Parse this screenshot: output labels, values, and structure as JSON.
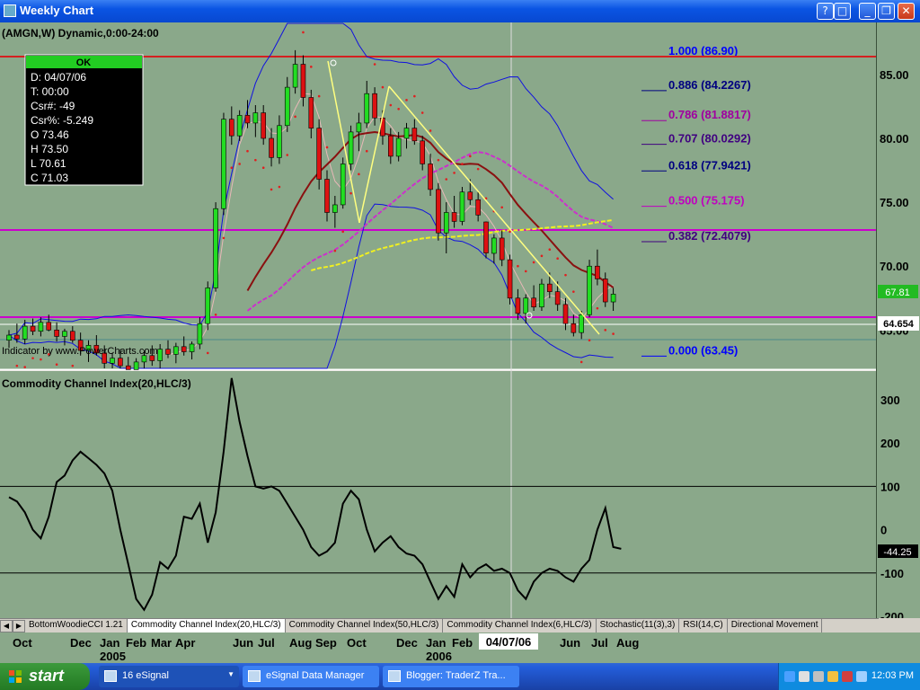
{
  "window": {
    "title": "Weekly Chart",
    "buttons": [
      "?",
      "□",
      "_",
      "❐",
      "✕"
    ]
  },
  "chart": {
    "symbol_label": "(AMGN,W) Dynamic,0:00-24:00",
    "cursor_box": {
      "ok": "OK",
      "rows": [
        "D: 04/07/06",
        "T: 00:00",
        "Csr#: -49",
        "Csr%: -5.249",
        "O 73.46",
        "H 73.50",
        "L 70.61",
        "C 71.03"
      ]
    },
    "indicator_credit": "Indicator by www.PowerCharts.com",
    "price_axis": [
      "85.00",
      "80.00",
      "75.00",
      "70.00",
      "65.00"
    ],
    "last_price_tag": "67.81",
    "hline_price_tag": "64.654",
    "fibs": [
      {
        "label": "1.000 (86.90)",
        "price": 86.9,
        "color": "#0000ff"
      },
      {
        "label": "0.886 (84.2267)",
        "price": 84.2267,
        "color": "#000080"
      },
      {
        "label": "0.786 (81.8817)",
        "price": 81.8817,
        "color": "#a000a0"
      },
      {
        "label": "0.707 (80.0292)",
        "price": 80.0292,
        "color": "#400080"
      },
      {
        "label": "0.618 (77.9421)",
        "price": 77.9421,
        "color": "#000080"
      },
      {
        "label": "0.500 (75.175)",
        "price": 75.175,
        "color": "#c000c0"
      },
      {
        "label": "0.382 (72.4079)",
        "price": 72.4079,
        "color": "#400080"
      },
      {
        "label": "0.000 (63.45)",
        "price": 63.45,
        "color": "#0000ff"
      }
    ]
  },
  "cci_panel": {
    "title": "Commodity Channel Index(20,HLC/3)",
    "axis": [
      "300",
      "200",
      "100",
      "0",
      "-100",
      "-200"
    ],
    "last_value": "-44.25"
  },
  "tabs": [
    "BottomWoodieCCI 1.21",
    "Commodity Channel Index(20,HLC/3)",
    "Commodity Channel Index(50,HLC/3)",
    "Commodity Channel Index(6,HLC/3)",
    "Stochastic(11(3),3)",
    "RSI(14,C)",
    "Directional Movement"
  ],
  "active_tab": 1,
  "time_axis": {
    "months": [
      "Oct",
      "Dec",
      "Jan",
      "Feb",
      "Mar",
      "Apr",
      "Jun",
      "Jul",
      "Aug",
      "Sep",
      "Oct",
      "Dec",
      "Jan",
      "Feb",
      "Jun",
      "Jul",
      "Aug"
    ],
    "years": [
      "2005",
      "2006"
    ],
    "cursor_date": "04/07/06"
  },
  "taskbar": {
    "start": "start",
    "items": [
      "16 eSignal",
      "eSignal Data Manager",
      "Blogger: TraderZ Tra..."
    ],
    "clock": "12:03 PM"
  },
  "chart_data": {
    "type": "candlestick",
    "title": "Weekly Chart",
    "ylim": [
      62,
      89
    ],
    "candles": [
      {
        "o": 64.2,
        "h": 65.0,
        "l": 63.6,
        "c": 64.6
      },
      {
        "o": 64.6,
        "h": 65.5,
        "l": 64.0,
        "c": 64.3
      },
      {
        "o": 64.3,
        "h": 65.8,
        "l": 63.9,
        "c": 65.3
      },
      {
        "o": 65.3,
        "h": 65.9,
        "l": 64.6,
        "c": 64.9
      },
      {
        "o": 64.9,
        "h": 66.0,
        "l": 64.5,
        "c": 65.6
      },
      {
        "o": 65.6,
        "h": 66.2,
        "l": 64.9,
        "c": 65.0
      },
      {
        "o": 65.0,
        "h": 65.6,
        "l": 64.1,
        "c": 64.5
      },
      {
        "o": 64.5,
        "h": 65.1,
        "l": 63.8,
        "c": 64.9
      },
      {
        "o": 64.9,
        "h": 65.3,
        "l": 64.0,
        "c": 64.2
      },
      {
        "o": 64.2,
        "h": 64.8,
        "l": 63.0,
        "c": 63.4
      },
      {
        "o": 63.4,
        "h": 64.2,
        "l": 62.5,
        "c": 63.8
      },
      {
        "o": 63.8,
        "h": 64.6,
        "l": 63.0,
        "c": 63.2
      },
      {
        "o": 63.2,
        "h": 63.8,
        "l": 62.0,
        "c": 62.4
      },
      {
        "o": 62.4,
        "h": 63.2,
        "l": 61.5,
        "c": 62.8
      },
      {
        "o": 62.8,
        "h": 63.5,
        "l": 61.8,
        "c": 62.2
      },
      {
        "o": 62.2,
        "h": 62.9,
        "l": 61.2,
        "c": 61.9
      },
      {
        "o": 61.9,
        "h": 62.8,
        "l": 61.3,
        "c": 62.5
      },
      {
        "o": 62.5,
        "h": 63.4,
        "l": 61.9,
        "c": 63.0
      },
      {
        "o": 63.0,
        "h": 63.8,
        "l": 62.2,
        "c": 62.6
      },
      {
        "o": 62.6,
        "h": 63.9,
        "l": 62.0,
        "c": 63.5
      },
      {
        "o": 63.5,
        "h": 64.2,
        "l": 62.8,
        "c": 63.1
      },
      {
        "o": 63.1,
        "h": 64.0,
        "l": 62.4,
        "c": 63.7
      },
      {
        "o": 63.7,
        "h": 64.5,
        "l": 63.0,
        "c": 63.3
      },
      {
        "o": 63.3,
        "h": 64.1,
        "l": 62.7,
        "c": 63.9
      },
      {
        "o": 63.9,
        "h": 66.0,
        "l": 63.5,
        "c": 65.5
      },
      {
        "o": 65.5,
        "h": 68.8,
        "l": 65.0,
        "c": 68.3
      },
      {
        "o": 68.3,
        "h": 75.0,
        "l": 68.0,
        "c": 74.5
      },
      {
        "o": 74.5,
        "h": 82.0,
        "l": 74.0,
        "c": 81.5
      },
      {
        "o": 81.5,
        "h": 82.5,
        "l": 79.5,
        "c": 80.2
      },
      {
        "o": 80.2,
        "h": 82.2,
        "l": 79.8,
        "c": 81.8
      },
      {
        "o": 81.8,
        "h": 83.0,
        "l": 80.8,
        "c": 81.2
      },
      {
        "o": 81.2,
        "h": 82.6,
        "l": 80.1,
        "c": 82.0
      },
      {
        "o": 82.0,
        "h": 82.6,
        "l": 79.5,
        "c": 80.0
      },
      {
        "o": 80.0,
        "h": 80.8,
        "l": 77.8,
        "c": 78.5
      },
      {
        "o": 78.5,
        "h": 81.8,
        "l": 78.0,
        "c": 81.0
      },
      {
        "o": 81.0,
        "h": 84.8,
        "l": 80.5,
        "c": 84.0
      },
      {
        "o": 84.0,
        "h": 86.9,
        "l": 83.5,
        "c": 85.8
      },
      {
        "o": 85.8,
        "h": 86.5,
        "l": 82.5,
        "c": 83.2
      },
      {
        "o": 83.2,
        "h": 83.8,
        "l": 80.0,
        "c": 80.8
      },
      {
        "o": 80.8,
        "h": 81.5,
        "l": 76.0,
        "c": 76.8
      },
      {
        "o": 76.8,
        "h": 77.5,
        "l": 73.5,
        "c": 74.2
      },
      {
        "o": 74.2,
        "h": 75.5,
        "l": 73.0,
        "c": 74.8
      },
      {
        "o": 74.8,
        "h": 78.5,
        "l": 74.5,
        "c": 78.0
      },
      {
        "o": 78.0,
        "h": 81.0,
        "l": 77.5,
        "c": 80.5
      },
      {
        "o": 80.5,
        "h": 82.0,
        "l": 79.0,
        "c": 81.2
      },
      {
        "o": 81.2,
        "h": 84.5,
        "l": 80.8,
        "c": 83.5
      },
      {
        "o": 83.5,
        "h": 84.0,
        "l": 81.0,
        "c": 81.6
      },
      {
        "o": 81.6,
        "h": 82.2,
        "l": 79.5,
        "c": 80.2
      },
      {
        "o": 80.2,
        "h": 80.8,
        "l": 78.0,
        "c": 78.6
      },
      {
        "o": 78.6,
        "h": 80.5,
        "l": 78.2,
        "c": 80.0
      },
      {
        "o": 80.0,
        "h": 81.2,
        "l": 79.2,
        "c": 80.8
      },
      {
        "o": 80.8,
        "h": 81.5,
        "l": 79.5,
        "c": 79.8
      },
      {
        "o": 79.8,
        "h": 80.2,
        "l": 77.5,
        "c": 78.0
      },
      {
        "o": 78.0,
        "h": 78.8,
        "l": 75.5,
        "c": 76.0
      },
      {
        "o": 76.0,
        "h": 76.5,
        "l": 72.0,
        "c": 72.6
      },
      {
        "o": 72.6,
        "h": 75.0,
        "l": 71.0,
        "c": 74.2
      },
      {
        "o": 74.2,
        "h": 75.5,
        "l": 73.0,
        "c": 73.5
      },
      {
        "o": 73.5,
        "h": 76.2,
        "l": 73.2,
        "c": 75.8
      },
      {
        "o": 75.8,
        "h": 76.8,
        "l": 74.8,
        "c": 75.2
      },
      {
        "o": 75.2,
        "h": 75.8,
        "l": 73.5,
        "c": 74.0
      },
      {
        "o": 73.46,
        "h": 73.5,
        "l": 70.61,
        "c": 71.03
      },
      {
        "o": 71.0,
        "h": 72.5,
        "l": 70.2,
        "c": 72.2
      },
      {
        "o": 72.2,
        "h": 72.8,
        "l": 70.0,
        "c": 70.5
      },
      {
        "o": 70.5,
        "h": 70.9,
        "l": 67.0,
        "c": 67.5
      },
      {
        "o": 67.5,
        "h": 68.2,
        "l": 65.8,
        "c": 66.3
      },
      {
        "o": 66.3,
        "h": 67.8,
        "l": 65.5,
        "c": 67.5
      },
      {
        "o": 67.5,
        "h": 68.5,
        "l": 66.5,
        "c": 66.8
      },
      {
        "o": 66.8,
        "h": 69.0,
        "l": 66.5,
        "c": 68.6
      },
      {
        "o": 68.6,
        "h": 69.5,
        "l": 67.5,
        "c": 68.0
      },
      {
        "o": 68.0,
        "h": 68.8,
        "l": 66.5,
        "c": 67.0
      },
      {
        "o": 67.0,
        "h": 67.5,
        "l": 65.0,
        "c": 65.5
      },
      {
        "o": 65.5,
        "h": 66.2,
        "l": 64.5,
        "c": 64.8
      },
      {
        "o": 64.8,
        "h": 66.5,
        "l": 64.3,
        "c": 66.2
      },
      {
        "o": 66.2,
        "h": 70.5,
        "l": 66.0,
        "c": 70.0
      },
      {
        "o": 70.0,
        "h": 71.3,
        "l": 68.5,
        "c": 69.0
      },
      {
        "o": 69.0,
        "h": 69.5,
        "l": 66.8,
        "c": 67.2
      },
      {
        "o": 67.2,
        "h": 68.3,
        "l": 66.5,
        "c": 67.81
      }
    ],
    "cci": [
      75,
      65,
      40,
      0,
      -20,
      30,
      110,
      125,
      160,
      180,
      165,
      150,
      130,
      90,
      0,
      -80,
      -160,
      -185,
      -150,
      -75,
      -90,
      -60,
      30,
      25,
      60,
      -30,
      40,
      180,
      350,
      250,
      170,
      100,
      95,
      100,
      90,
      60,
      30,
      0,
      -40,
      -60,
      -50,
      -30,
      60,
      90,
      70,
      0,
      -50,
      -30,
      -15,
      -40,
      -55,
      -60,
      -80,
      -120,
      -160,
      -130,
      -155,
      -80,
      -110,
      -90,
      -80,
      -95,
      -90,
      -100,
      -140,
      -160,
      -120,
      -100,
      -90,
      -95,
      -110,
      -120,
      -90,
      -70,
      0,
      50,
      -40,
      -44.25
    ],
    "cci_levels": [
      100,
      -100
    ],
    "cci_ylim": [
      -200,
      360
    ]
  }
}
